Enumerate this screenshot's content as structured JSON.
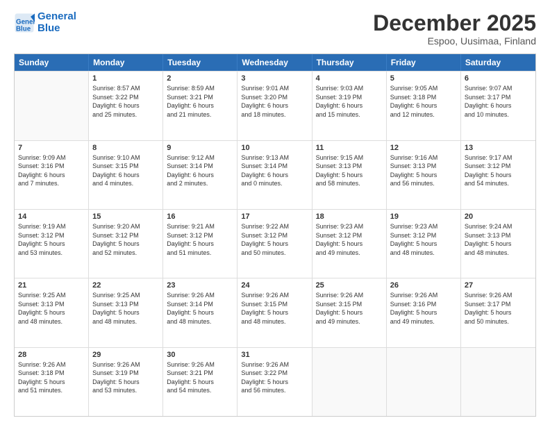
{
  "header": {
    "logo_line1": "General",
    "logo_line2": "Blue",
    "month": "December 2025",
    "location": "Espoo, Uusimaa, Finland"
  },
  "weekdays": [
    "Sunday",
    "Monday",
    "Tuesday",
    "Wednesday",
    "Thursday",
    "Friday",
    "Saturday"
  ],
  "rows": [
    [
      {
        "day": "",
        "text": ""
      },
      {
        "day": "1",
        "text": "Sunrise: 8:57 AM\nSunset: 3:22 PM\nDaylight: 6 hours\nand 25 minutes."
      },
      {
        "day": "2",
        "text": "Sunrise: 8:59 AM\nSunset: 3:21 PM\nDaylight: 6 hours\nand 21 minutes."
      },
      {
        "day": "3",
        "text": "Sunrise: 9:01 AM\nSunset: 3:20 PM\nDaylight: 6 hours\nand 18 minutes."
      },
      {
        "day": "4",
        "text": "Sunrise: 9:03 AM\nSunset: 3:19 PM\nDaylight: 6 hours\nand 15 minutes."
      },
      {
        "day": "5",
        "text": "Sunrise: 9:05 AM\nSunset: 3:18 PM\nDaylight: 6 hours\nand 12 minutes."
      },
      {
        "day": "6",
        "text": "Sunrise: 9:07 AM\nSunset: 3:17 PM\nDaylight: 6 hours\nand 10 minutes."
      }
    ],
    [
      {
        "day": "7",
        "text": "Sunrise: 9:09 AM\nSunset: 3:16 PM\nDaylight: 6 hours\nand 7 minutes."
      },
      {
        "day": "8",
        "text": "Sunrise: 9:10 AM\nSunset: 3:15 PM\nDaylight: 6 hours\nand 4 minutes."
      },
      {
        "day": "9",
        "text": "Sunrise: 9:12 AM\nSunset: 3:14 PM\nDaylight: 6 hours\nand 2 minutes."
      },
      {
        "day": "10",
        "text": "Sunrise: 9:13 AM\nSunset: 3:14 PM\nDaylight: 6 hours\nand 0 minutes."
      },
      {
        "day": "11",
        "text": "Sunrise: 9:15 AM\nSunset: 3:13 PM\nDaylight: 5 hours\nand 58 minutes."
      },
      {
        "day": "12",
        "text": "Sunrise: 9:16 AM\nSunset: 3:13 PM\nDaylight: 5 hours\nand 56 minutes."
      },
      {
        "day": "13",
        "text": "Sunrise: 9:17 AM\nSunset: 3:12 PM\nDaylight: 5 hours\nand 54 minutes."
      }
    ],
    [
      {
        "day": "14",
        "text": "Sunrise: 9:19 AM\nSunset: 3:12 PM\nDaylight: 5 hours\nand 53 minutes."
      },
      {
        "day": "15",
        "text": "Sunrise: 9:20 AM\nSunset: 3:12 PM\nDaylight: 5 hours\nand 52 minutes."
      },
      {
        "day": "16",
        "text": "Sunrise: 9:21 AM\nSunset: 3:12 PM\nDaylight: 5 hours\nand 51 minutes."
      },
      {
        "day": "17",
        "text": "Sunrise: 9:22 AM\nSunset: 3:12 PM\nDaylight: 5 hours\nand 50 minutes."
      },
      {
        "day": "18",
        "text": "Sunrise: 9:23 AM\nSunset: 3:12 PM\nDaylight: 5 hours\nand 49 minutes."
      },
      {
        "day": "19",
        "text": "Sunrise: 9:23 AM\nSunset: 3:12 PM\nDaylight: 5 hours\nand 48 minutes."
      },
      {
        "day": "20",
        "text": "Sunrise: 9:24 AM\nSunset: 3:13 PM\nDaylight: 5 hours\nand 48 minutes."
      }
    ],
    [
      {
        "day": "21",
        "text": "Sunrise: 9:25 AM\nSunset: 3:13 PM\nDaylight: 5 hours\nand 48 minutes."
      },
      {
        "day": "22",
        "text": "Sunrise: 9:25 AM\nSunset: 3:13 PM\nDaylight: 5 hours\nand 48 minutes."
      },
      {
        "day": "23",
        "text": "Sunrise: 9:26 AM\nSunset: 3:14 PM\nDaylight: 5 hours\nand 48 minutes."
      },
      {
        "day": "24",
        "text": "Sunrise: 9:26 AM\nSunset: 3:15 PM\nDaylight: 5 hours\nand 48 minutes."
      },
      {
        "day": "25",
        "text": "Sunrise: 9:26 AM\nSunset: 3:15 PM\nDaylight: 5 hours\nand 49 minutes."
      },
      {
        "day": "26",
        "text": "Sunrise: 9:26 AM\nSunset: 3:16 PM\nDaylight: 5 hours\nand 49 minutes."
      },
      {
        "day": "27",
        "text": "Sunrise: 9:26 AM\nSunset: 3:17 PM\nDaylight: 5 hours\nand 50 minutes."
      }
    ],
    [
      {
        "day": "28",
        "text": "Sunrise: 9:26 AM\nSunset: 3:18 PM\nDaylight: 5 hours\nand 51 minutes."
      },
      {
        "day": "29",
        "text": "Sunrise: 9:26 AM\nSunset: 3:19 PM\nDaylight: 5 hours\nand 53 minutes."
      },
      {
        "day": "30",
        "text": "Sunrise: 9:26 AM\nSunset: 3:21 PM\nDaylight: 5 hours\nand 54 minutes."
      },
      {
        "day": "31",
        "text": "Sunrise: 9:26 AM\nSunset: 3:22 PM\nDaylight: 5 hours\nand 56 minutes."
      },
      {
        "day": "",
        "text": ""
      },
      {
        "day": "",
        "text": ""
      },
      {
        "day": "",
        "text": ""
      }
    ]
  ]
}
